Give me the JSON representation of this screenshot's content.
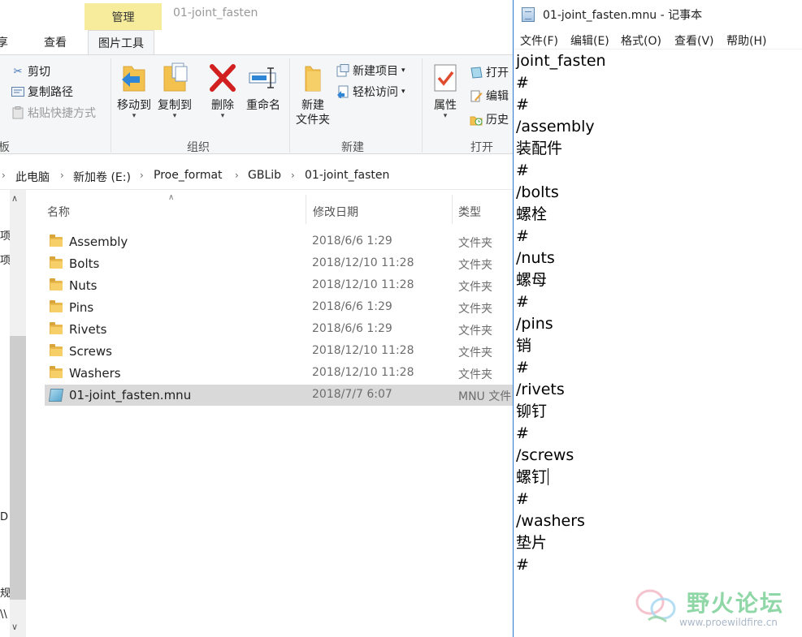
{
  "explorer": {
    "window_title": "01-joint_fasten",
    "context_tab": "管理",
    "tabs": [
      "享",
      "查看",
      "图片工具"
    ],
    "ribbon": {
      "clipboard": {
        "cut": "剪切",
        "copy_path": "复制路径",
        "paste_shortcut": "粘贴快捷方式",
        "group_label": "板"
      },
      "organize": {
        "move_to": "移动到",
        "copy_to": "复制到",
        "delete": "删除",
        "rename": "重命名",
        "group_label": "组织"
      },
      "new": {
        "new_folder_line1": "新建",
        "new_folder_line2": "文件夹",
        "new_item": "新建项目",
        "easy_access": "轻松访问",
        "group_label": "新建"
      },
      "open": {
        "properties": "属性",
        "open": "打开",
        "edit": "编辑",
        "history": "历史",
        "group_label": "打开"
      }
    },
    "breadcrumb": [
      "此电脑",
      "新加卷 (E:)",
      "Proe_format",
      "GBLib",
      "01-joint_fasten"
    ],
    "nav_fragments": [
      "项",
      "项",
      "D (",
      "规划",
      "\\\\"
    ],
    "columns": {
      "name": "名称",
      "date": "修改日期",
      "type": "类型"
    },
    "files": [
      {
        "name": "Assembly",
        "date": "2018/6/6 1:29",
        "type": "文件夹",
        "kind": "folder"
      },
      {
        "name": "Bolts",
        "date": "2018/12/10 11:28",
        "type": "文件夹",
        "kind": "folder"
      },
      {
        "name": "Nuts",
        "date": "2018/12/10 11:28",
        "type": "文件夹",
        "kind": "folder"
      },
      {
        "name": "Pins",
        "date": "2018/6/6 1:29",
        "type": "文件夹",
        "kind": "folder"
      },
      {
        "name": "Rivets",
        "date": "2018/6/6 1:29",
        "type": "文件夹",
        "kind": "folder"
      },
      {
        "name": "Screws",
        "date": "2018/12/10 11:28",
        "type": "文件夹",
        "kind": "folder"
      },
      {
        "name": "Washers",
        "date": "2018/12/10 11:28",
        "type": "文件夹",
        "kind": "folder"
      },
      {
        "name": "01-joint_fasten.mnu",
        "date": "2018/7/7 6:07",
        "type": "MNU 文件",
        "kind": "file",
        "selected": true
      }
    ]
  },
  "notepad": {
    "title": "01-joint_fasten.mnu - 记事本",
    "menu": [
      "文件(F)",
      "编辑(E)",
      "格式(O)",
      "查看(V)",
      "帮助(H)"
    ],
    "lines": [
      "joint_fasten",
      "#",
      "#",
      "/assembly",
      "装配件",
      "#",
      "/bolts",
      "螺栓",
      "#",
      "/nuts",
      "螺母",
      "#",
      "/pins",
      "销",
      "#",
      "/rivets",
      "铆钉",
      "#",
      "/screws",
      "螺钉",
      "#",
      "/washers",
      "垫片",
      "#"
    ],
    "caret_line": 19
  },
  "watermark": {
    "name": "野火论坛",
    "url": "www.proewildfire.cn"
  },
  "colors": {
    "accent": "#2b79d3",
    "context_tab": "#f7ec9c",
    "selection": "#d9d9d9",
    "folder": "#f7cf68",
    "delete_red": "#d21f1f"
  }
}
